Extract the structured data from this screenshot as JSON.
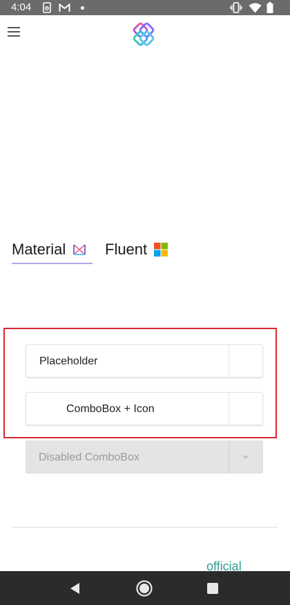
{
  "status_bar": {
    "time": "4:04",
    "icons": [
      "phone-sync-icon",
      "gmail-icon",
      "notification-dot-icon",
      "vibrate-icon",
      "wifi-icon",
      "battery-icon"
    ]
  },
  "header": {
    "menu_icon": "hamburger-menu-icon",
    "logo_icon": "app-logo-icon"
  },
  "tabs": [
    {
      "label": "Material",
      "icon": "material-logo-icon",
      "selected": true
    },
    {
      "label": "Fluent",
      "icon": "windows-logo-icon",
      "selected": false
    }
  ],
  "comboboxes": [
    {
      "text": "Placeholder",
      "enabled": true
    },
    {
      "text": "ComboBox + Icon",
      "enabled": true
    },
    {
      "text": "Disabled ComboBox",
      "enabled": false
    }
  ],
  "footer": {
    "link_text": "official"
  },
  "colors": {
    "status_bar": "#6b6b6b",
    "tab_underline": "#b3a6e8",
    "highlight_border": "#d7252f",
    "link": "#2f9e92",
    "nav_bar": "#2b2b2b"
  },
  "nav_bar": {
    "buttons": [
      "back-icon",
      "home-icon",
      "recents-icon"
    ]
  }
}
